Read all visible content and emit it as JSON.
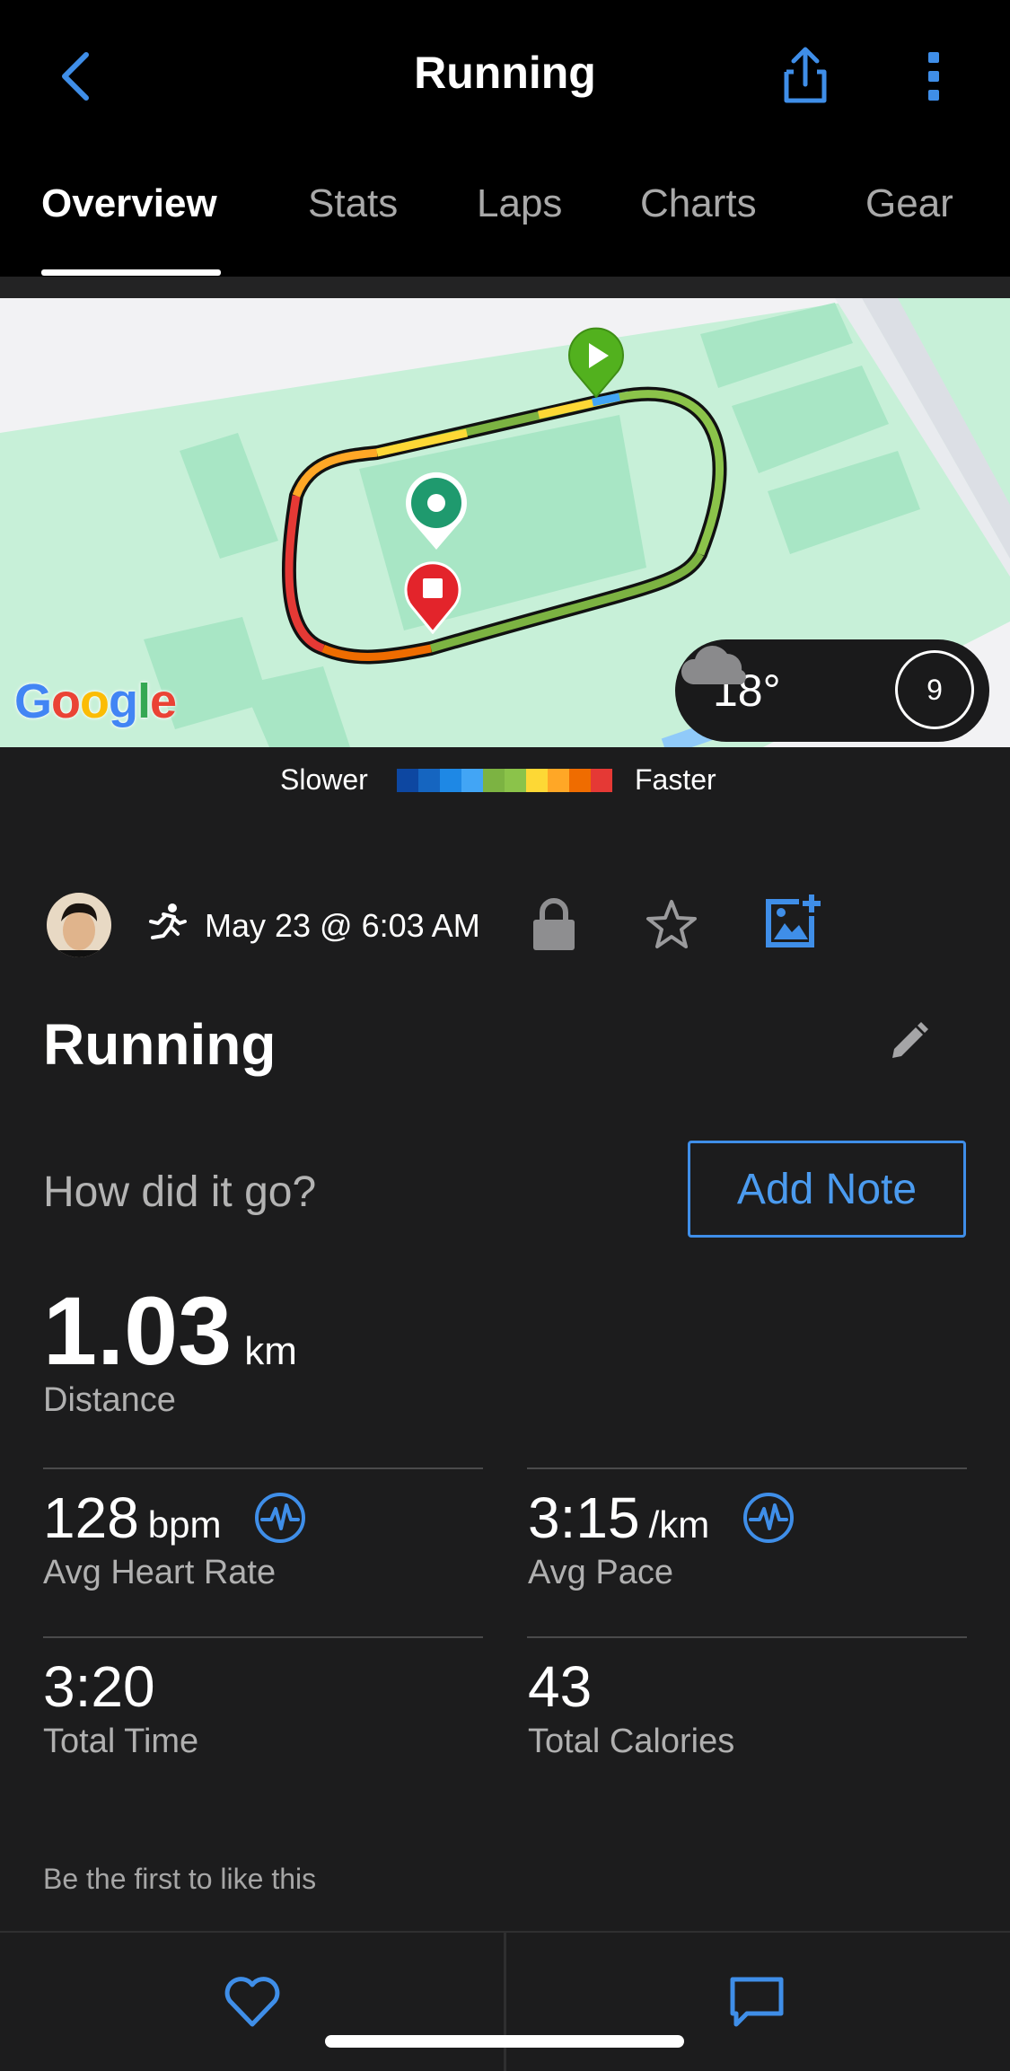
{
  "header": {
    "title": "Running",
    "tabs": [
      {
        "label": "Overview",
        "active": true
      },
      {
        "label": "Stats",
        "active": false
      },
      {
        "label": "Laps",
        "active": false
      },
      {
        "label": "Charts",
        "active": false
      },
      {
        "label": "Gear",
        "active": false
      }
    ]
  },
  "map": {
    "logo_text": "Google",
    "weather": {
      "temperature": "18°",
      "wind": "9",
      "condition_icon": "cloud-icon"
    }
  },
  "legend": {
    "slower_label": "Slower",
    "faster_label": "Faster",
    "colors": [
      "#0d47a1",
      "#1565c0",
      "#1e88e5",
      "#42a5f5",
      "#7cb342",
      "#8bc34a",
      "#fdd835",
      "#ffa726",
      "#ef6c00",
      "#e53935"
    ]
  },
  "activity": {
    "date": "May 23 @ 6:03 AM",
    "title": "Running",
    "prompt": "How did it go?",
    "add_note_label": "Add Note"
  },
  "stats": {
    "distance": {
      "value": "1.03",
      "unit": "km",
      "label": "Distance"
    },
    "avg_heart_rate": {
      "value": "128",
      "unit": "bpm",
      "label": "Avg Heart Rate"
    },
    "avg_pace": {
      "value": "3:15",
      "unit": "/km",
      "label": "Avg Pace"
    },
    "total_time": {
      "value": "3:20",
      "label": "Total Time"
    },
    "total_calories": {
      "value": "43",
      "label": "Total Calories"
    }
  },
  "social": {
    "likes_text": "Be the first to like this"
  },
  "colors": {
    "accent": "#4b9bef",
    "background": "#1c1c1d",
    "header": "#000000",
    "map_green": "#c7f0d8",
    "start_marker": "#52b11e",
    "stop_marker": "#e3242b",
    "lap_marker": "#1f9a6e"
  }
}
